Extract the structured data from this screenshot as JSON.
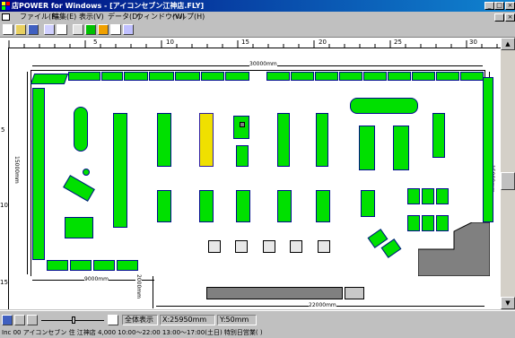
{
  "window": {
    "title": "店POWER for Windows - [アイコンセブン江神店.FLY]",
    "min_label": "_",
    "max_label": "□",
    "close_label": "×"
  },
  "menu": {
    "items": [
      "ファイル(F)",
      "編集(E)",
      "表示(V)",
      "データ(D)",
      "ウィンドウ(W)",
      "ヘルプ(H)"
    ]
  },
  "ruler": {
    "top_ticks": [
      "5",
      "10",
      "15",
      "20",
      "25",
      "30"
    ],
    "left_ticks": [
      "5",
      "10",
      "15"
    ]
  },
  "dimensions": {
    "total_width": "30000mm",
    "total_height": "15000mm",
    "right_height": "15000mm",
    "sub_width_left": "9000mm",
    "sub_height": "2000mm",
    "sub_width_bottom": "22000mm"
  },
  "status": {
    "view_all": "全体表示",
    "x_coord": "X:25950mm",
    "y_coord": "Y:50mm",
    "line": "Inc 00  アイコンセブン  住  江神店  4,000  10:00〜22:00  13:00〜17:00(土日)  特別日営業(  )"
  },
  "colors": {
    "fixture_fill": "#00e000",
    "fixture_highlight": "#f0e000",
    "fixture_gray": "#808080",
    "titlebar_start": "#000a80",
    "titlebar_end": "#1084d0"
  }
}
